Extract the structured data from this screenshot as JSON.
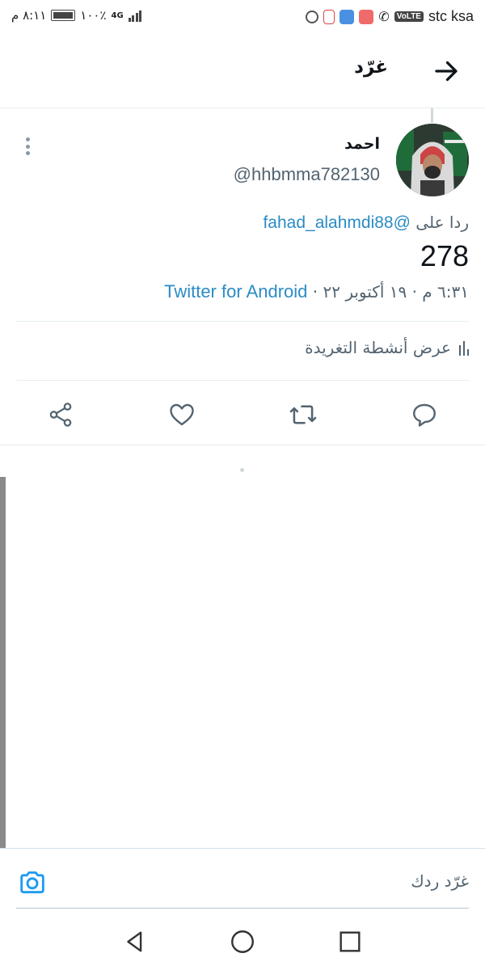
{
  "status_bar": {
    "time": "٨:١١ م",
    "battery": "١٠٠٪",
    "network_type": "4G",
    "carrier": "stc ksa",
    "volte": "VoLTE"
  },
  "header": {
    "title": "غرّد"
  },
  "tweet": {
    "name": "احمد",
    "handle": "@hhbmma782130",
    "reply_label": "ردا على",
    "reply_to": "@fahad_alahmdi88",
    "text": "278",
    "timestamp": "٦:٣١ م · ١٩ أكتوبر ٢٢ ·",
    "source": "Twitter for Android",
    "activity_label": "عرض أنشطة التغريدة"
  },
  "compose": {
    "placeholder": "غرّد ردك"
  },
  "colors": {
    "link": "#2b8cc4",
    "accent": "#1d9bf0",
    "muted": "#536471",
    "icon": "#536471"
  }
}
